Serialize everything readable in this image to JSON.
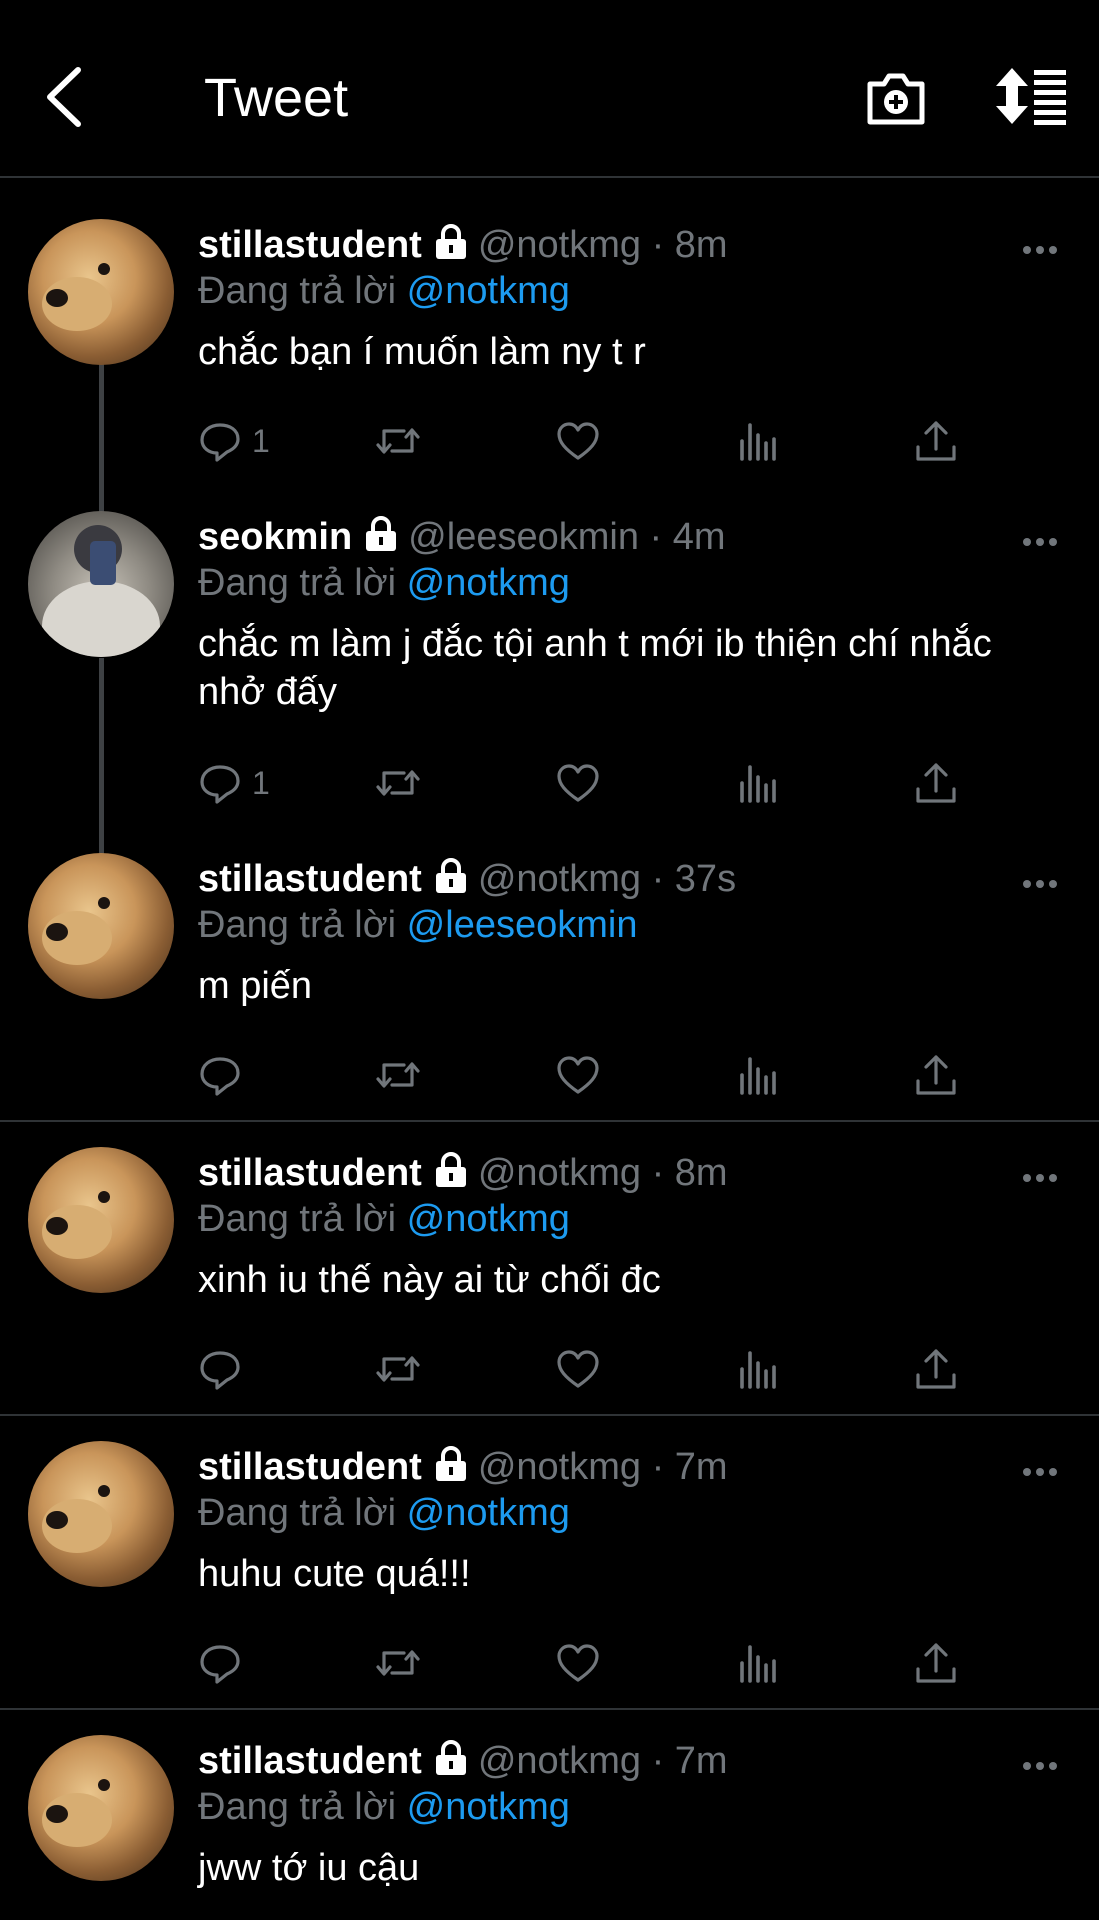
{
  "header": {
    "title": "Tweet"
  },
  "tweets": [
    {
      "username": "stillastudent",
      "handle": "@notkmg",
      "dot": "·",
      "time": "8m",
      "replying_label": "Đang trả lời",
      "replying_to": "@notkmg",
      "text": "chắc bạn í muốn làm ny t r",
      "reply_count": "1",
      "avatar": "dog"
    },
    {
      "username": "seokmin",
      "handle": "@leeseokmin",
      "dot": "·",
      "time": "4m",
      "replying_label": "Đang trả lời",
      "replying_to": "@notkmg",
      "text": "chắc m làm j đắc tội anh t mới ib thiện chí nhắc nhở đấy",
      "reply_count": "1",
      "avatar": "person"
    },
    {
      "username": "stillastudent",
      "handle": "@notkmg",
      "dot": "·",
      "time": "37s",
      "replying_label": "Đang trả lời",
      "replying_to": "@leeseokmin",
      "text": "m piến",
      "reply_count": "",
      "avatar": "dog"
    },
    {
      "username": "stillastudent",
      "handle": "@notkmg",
      "dot": "·",
      "time": "8m",
      "replying_label": "Đang trả lời",
      "replying_to": "@notkmg",
      "text": "xinh iu thế này ai từ chối đc",
      "reply_count": "",
      "avatar": "dog"
    },
    {
      "username": "stillastudent",
      "handle": "@notkmg",
      "dot": "·",
      "time": "7m",
      "replying_label": "Đang trả lời",
      "replying_to": "@notkmg",
      "text": "huhu cute quá!!!",
      "reply_count": "",
      "avatar": "dog"
    },
    {
      "username": "stillastudent",
      "handle": "@notkmg",
      "dot": "·",
      "time": "7m",
      "replying_label": "Đang trả lời",
      "replying_to": "@notkmg",
      "text": "jww tớ iu cậu",
      "reply_count": "",
      "avatar": "dog"
    }
  ],
  "icons": [
    "back-arrow-icon",
    "camera-plus-icon",
    "sort-icon",
    "lock-icon",
    "more-icon",
    "reply-icon",
    "retweet-icon",
    "like-icon",
    "analytics-icon",
    "share-icon"
  ],
  "colors": {
    "background": "#000000",
    "text": "#e7e9ea",
    "muted": "#71767b",
    "accent": "#1d9bf0",
    "divider": "#2f3336"
  }
}
